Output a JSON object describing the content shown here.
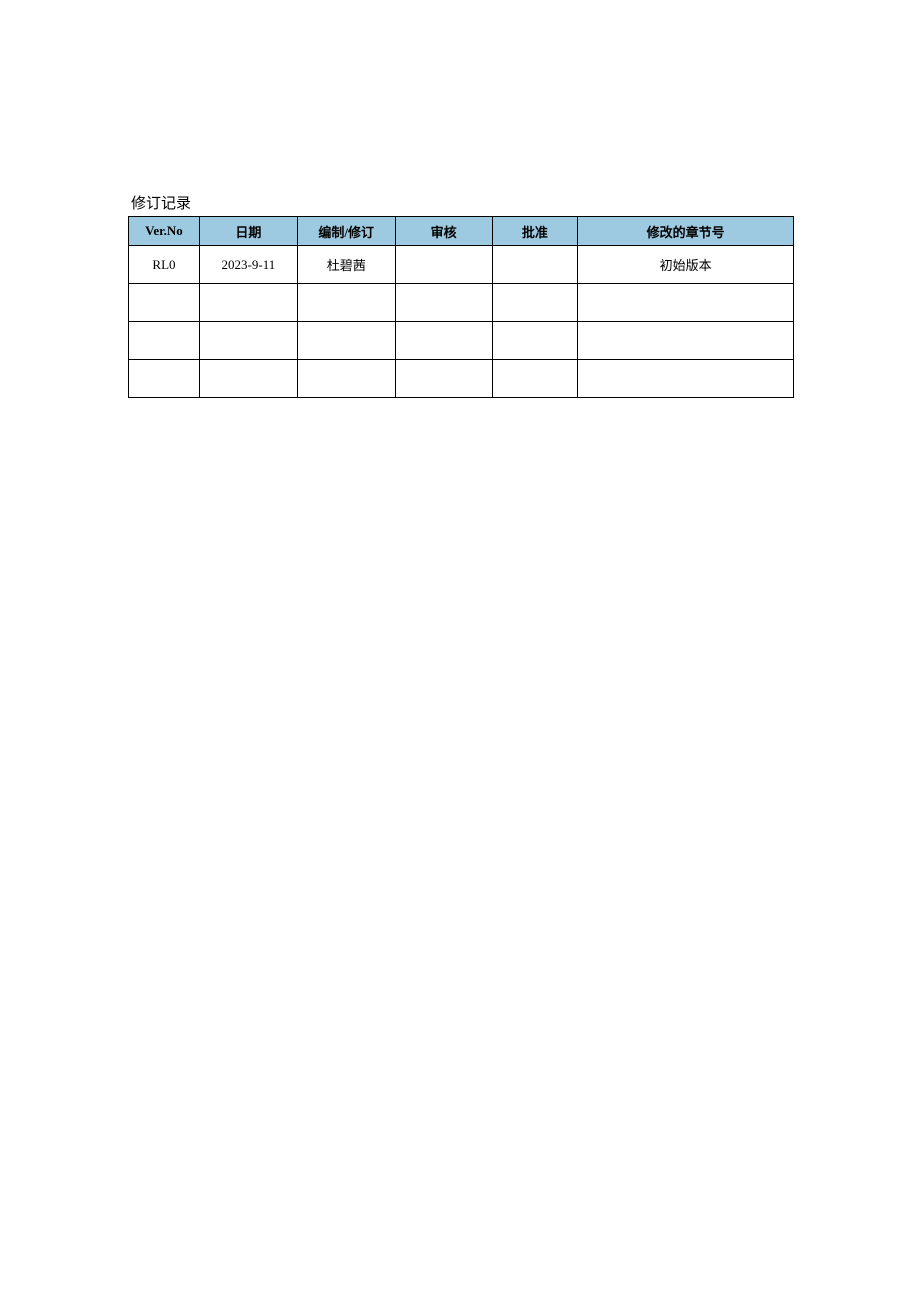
{
  "title": "修订记录",
  "headers": {
    "verNo": "Ver.No",
    "date": "日期",
    "author": "编制/修订",
    "review": "审核",
    "approve": "批准",
    "chapter": "修改的章节号"
  },
  "rows": [
    {
      "verNo": "RL0",
      "date": "2023-9-11",
      "author": "杜碧茜",
      "review": "",
      "approve": "",
      "chapter": "初始版本"
    },
    {
      "verNo": "",
      "date": "",
      "author": "",
      "review": "",
      "approve": "",
      "chapter": ""
    },
    {
      "verNo": "",
      "date": "",
      "author": "",
      "review": "",
      "approve": "",
      "chapter": ""
    },
    {
      "verNo": "",
      "date": "",
      "author": "",
      "review": "",
      "approve": "",
      "chapter": ""
    }
  ]
}
